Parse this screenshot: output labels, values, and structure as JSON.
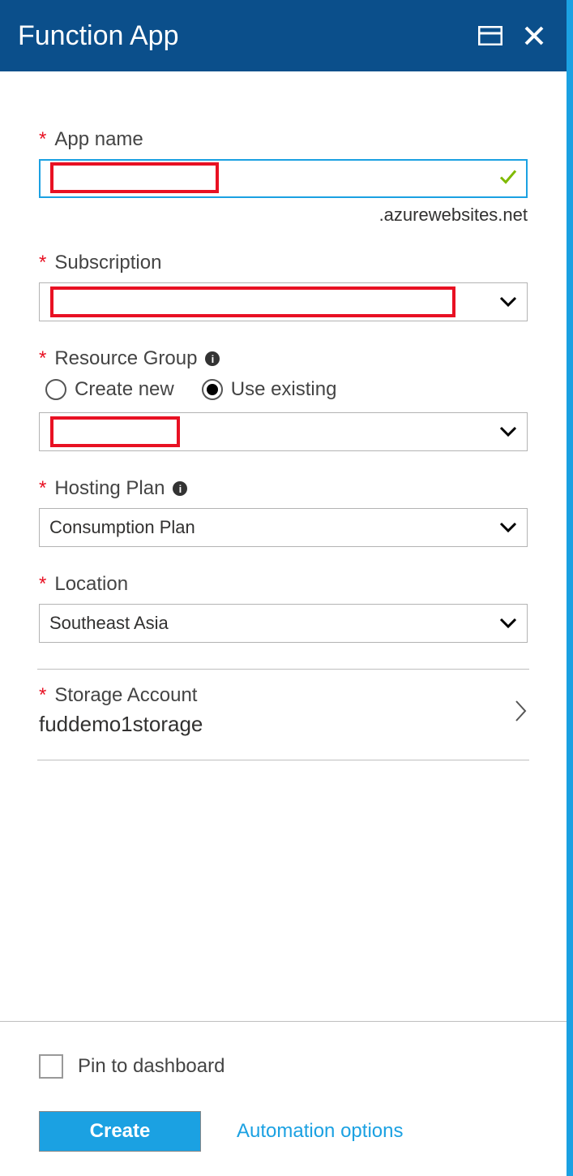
{
  "header": {
    "title": "Function App"
  },
  "fields": {
    "app_name": {
      "label": "App name",
      "value": "",
      "suffix": ".azurewebsites.net",
      "validated": true
    },
    "subscription": {
      "label": "Subscription",
      "value": ""
    },
    "resource_group": {
      "label": "Resource Group",
      "create_new_label": "Create new",
      "use_existing_label": "Use existing",
      "selected_mode": "use_existing",
      "value": ""
    },
    "hosting_plan": {
      "label": "Hosting Plan",
      "value": "Consumption Plan"
    },
    "location": {
      "label": "Location",
      "value": "Southeast Asia"
    },
    "storage_account": {
      "label": "Storage Account",
      "value": "fuddemo1storage"
    }
  },
  "footer": {
    "pin_label": "Pin to dashboard",
    "create_label": "Create",
    "automation_label": "Automation options"
  }
}
